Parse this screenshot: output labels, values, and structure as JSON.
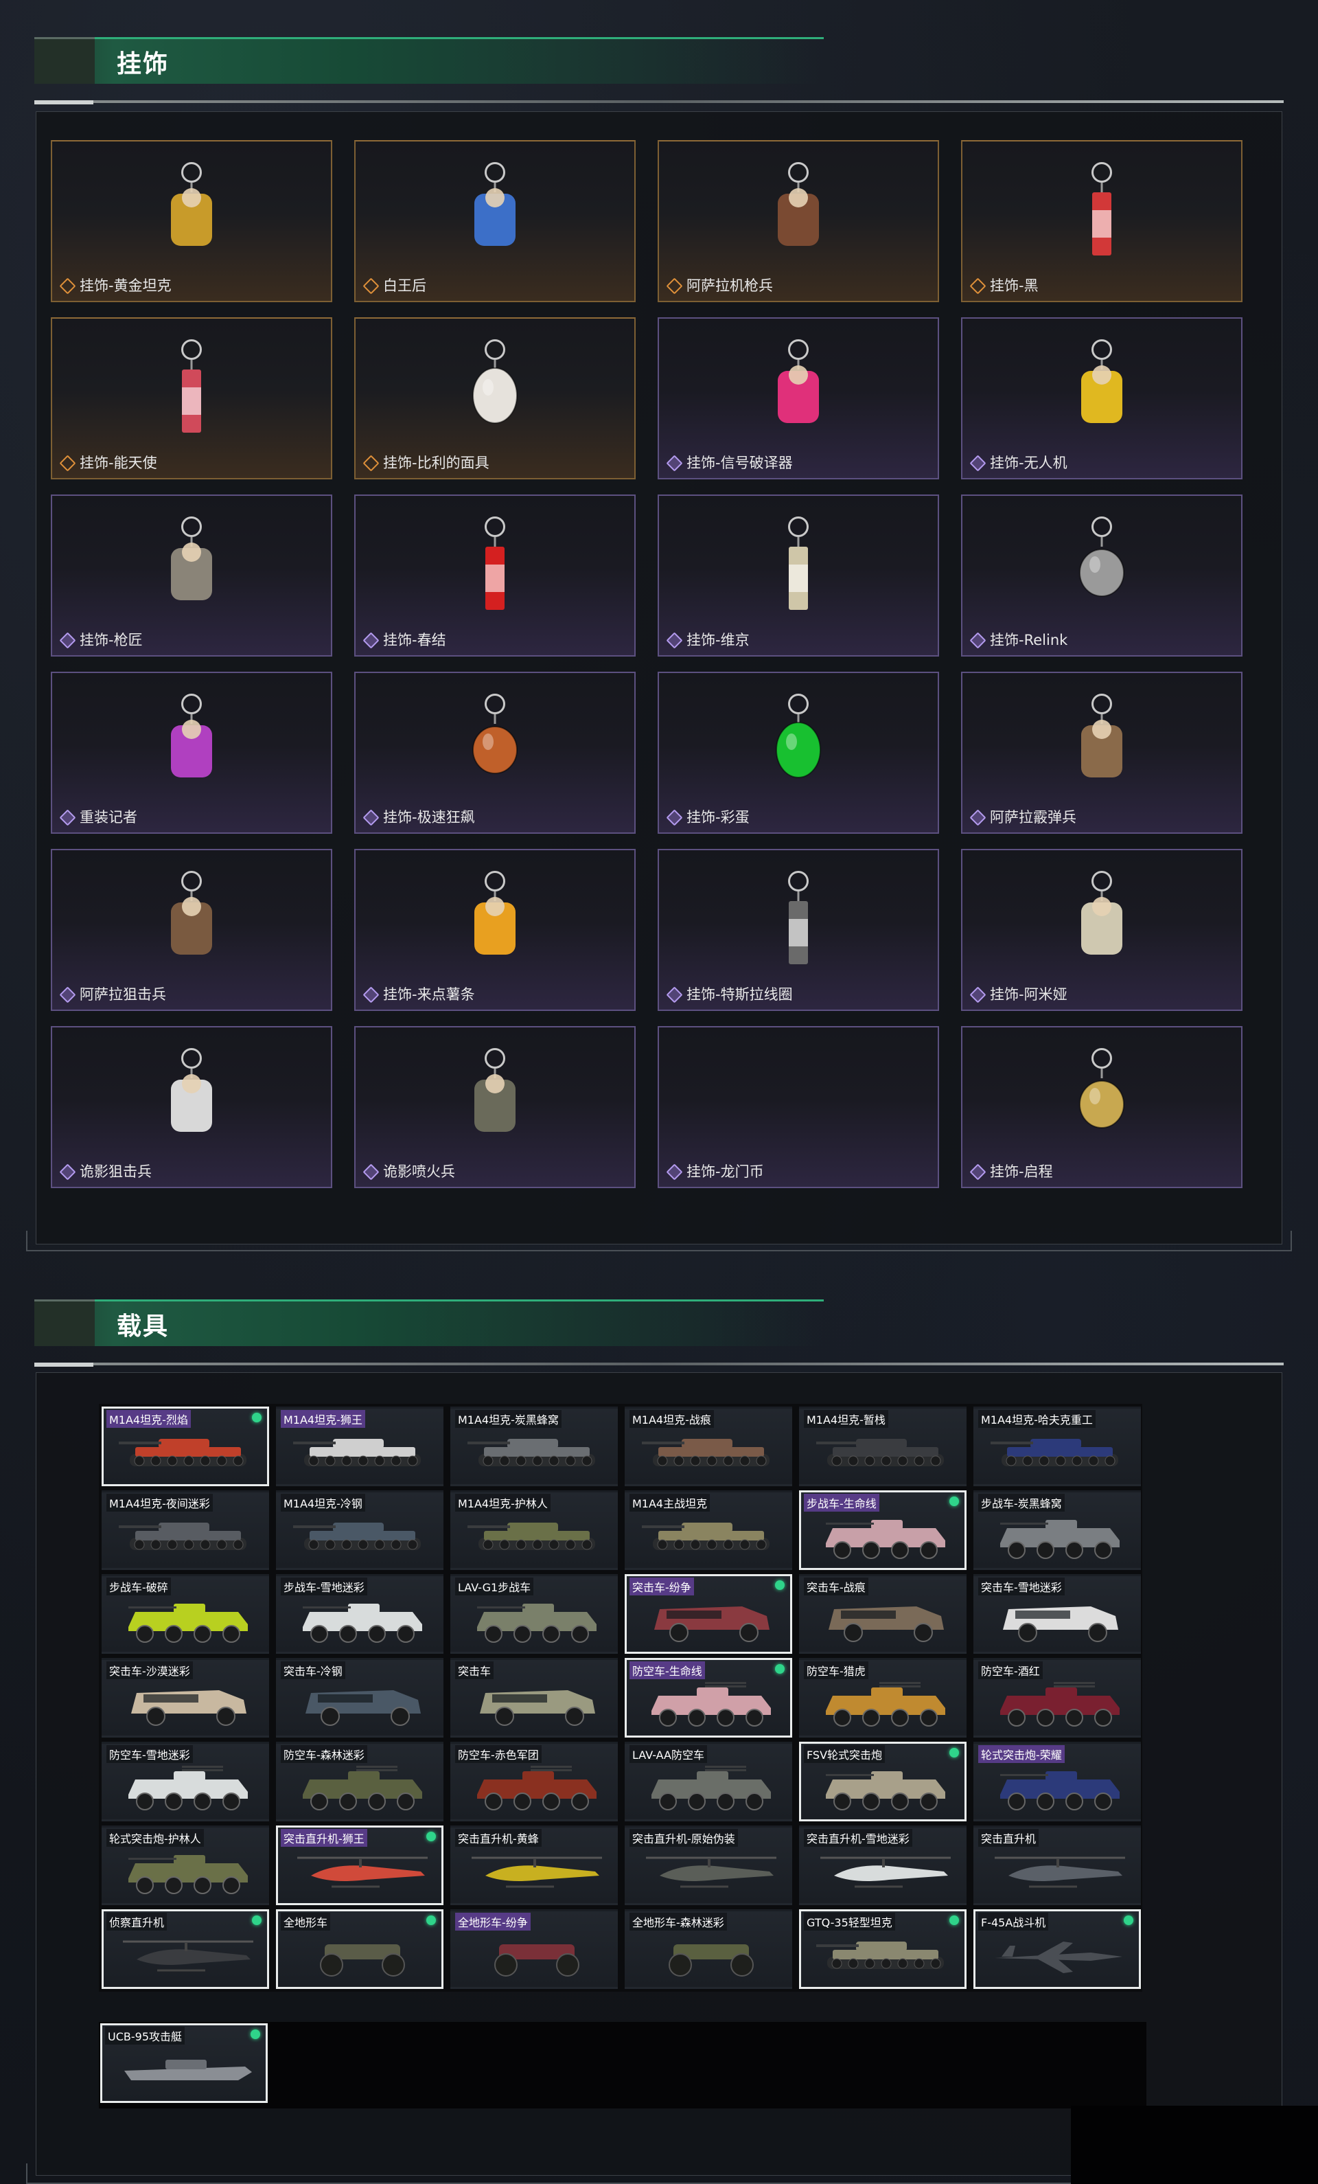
{
  "sections": {
    "charms": {
      "title": "挂饰"
    },
    "vehicles": {
      "title": "载具"
    }
  },
  "colors": {
    "accent_green": "#2fae7a",
    "rarity_gold": "#e0913a",
    "rarity_purple": "#b59cf0",
    "equipped_dot": "#2fd48a"
  },
  "charms": [
    {
      "name": "挂饰-黄金坦克",
      "rarity": "gold",
      "icon": "golden-tank-charm-icon",
      "color": "#c89b2a"
    },
    {
      "name": "白王后",
      "rarity": "gold",
      "icon": "white-queen-charm-icon",
      "color": "#3c6fc8"
    },
    {
      "name": "阿萨拉机枪兵",
      "rarity": "gold",
      "icon": "machine-gunner-charm-icon",
      "color": "#7a4a32"
    },
    {
      "name": "挂饰-黑",
      "rarity": "gold",
      "icon": "black-tag-charm-icon",
      "color": "#d23838"
    },
    {
      "name": "挂饰-能天使",
      "rarity": "gold",
      "icon": "exusiai-charm-icon",
      "color": "#d04a5a"
    },
    {
      "name": "挂饰-比利的面具",
      "rarity": "gold",
      "icon": "billy-mask-charm-icon",
      "color": "#e6e2dc"
    },
    {
      "name": "挂饰-信号破译器",
      "rarity": "purple",
      "icon": "signal-decoder-charm-icon",
      "color": "#e0307a"
    },
    {
      "name": "挂饰-无人机",
      "rarity": "purple",
      "icon": "drone-charm-icon",
      "color": "#e0b820"
    },
    {
      "name": "挂饰-枪匠",
      "rarity": "purple",
      "icon": "gunsmith-charm-icon",
      "color": "#8a8478"
    },
    {
      "name": "挂饰-春结",
      "rarity": "purple",
      "icon": "chinese-knot-charm-icon",
      "color": "#d42020"
    },
    {
      "name": "挂饰-维京",
      "rarity": "purple",
      "icon": "viking-hammer-charm-icon",
      "color": "#cfc6a8"
    },
    {
      "name": "挂饰-Relink",
      "rarity": "purple",
      "icon": "relink-emblem-charm-icon",
      "color": "#9a9a9a"
    },
    {
      "name": "重装记者",
      "rarity": "purple",
      "icon": "heavy-reporter-charm-icon",
      "color": "#b040c0"
    },
    {
      "name": "挂饰-极速狂飙",
      "rarity": "purple",
      "icon": "wheel-charm-icon",
      "color": "#c0602a"
    },
    {
      "name": "挂饰-彩蛋",
      "rarity": "purple",
      "icon": "easter-egg-charm-icon",
      "color": "#18c030"
    },
    {
      "name": "阿萨拉霰弹兵",
      "rarity": "purple",
      "icon": "shotgunner-charm-icon",
      "color": "#8a6a4a"
    },
    {
      "name": "阿萨拉狙击兵",
      "rarity": "purple",
      "icon": "sniper-charm-icon",
      "color": "#7a5a40"
    },
    {
      "name": "挂饰-来点薯条",
      "rarity": "purple",
      "icon": "fries-charm-icon",
      "color": "#e8a020"
    },
    {
      "name": "挂饰-特斯拉线圈",
      "rarity": "purple",
      "icon": "tesla-coil-charm-icon",
      "color": "#6a6a6a"
    },
    {
      "name": "挂饰-阿米娅",
      "rarity": "purple",
      "icon": "amiya-charm-icon",
      "color": "#cfc8b0"
    },
    {
      "name": "诡影狙击兵",
      "rarity": "purple",
      "icon": "shadow-sniper-charm-icon",
      "color": "#d8d8d8"
    },
    {
      "name": "诡影喷火兵",
      "rarity": "purple",
      "icon": "shadow-flamer-charm-icon",
      "color": "#6a6a5a"
    },
    {
      "name": "挂饰-龙门币",
      "rarity": "purple",
      "icon": "",
      "color": ""
    },
    {
      "name": "挂饰-启程",
      "rarity": "purple",
      "icon": "departure-coin-charm-icon",
      "color": "#c8a850"
    }
  ],
  "vehicles": [
    {
      "name": "M1A4坦克-烈焰",
      "type": "tank",
      "color": "#c0402a",
      "equipped": true,
      "tagged": true
    },
    {
      "name": "M1A4坦克-狮王",
      "type": "tank",
      "color": "#cfcfcf",
      "equipped": false,
      "tagged": true
    },
    {
      "name": "M1A4坦克-炭黑蜂窝",
      "type": "tank",
      "color": "#6a6e72",
      "equipped": false,
      "tagged": false
    },
    {
      "name": "M1A4坦克-战痕",
      "type": "tank",
      "color": "#7a5a48",
      "equipped": false,
      "tagged": false
    },
    {
      "name": "M1A4坦克-暂栈",
      "type": "tank",
      "color": "#3a3c40",
      "equipped": false,
      "tagged": false
    },
    {
      "name": "M1A4坦克-哈夫克重工",
      "type": "tank",
      "color": "#2c3a7a",
      "equipped": false,
      "tagged": false
    },
    {
      "name": "M1A4坦克-夜间迷彩",
      "type": "tank",
      "color": "#585c62",
      "equipped": false,
      "tagged": false
    },
    {
      "name": "M1A4坦克-冷钢",
      "type": "tank",
      "color": "#4a5866",
      "equipped": false,
      "tagged": false
    },
    {
      "name": "M1A4坦克-护林人",
      "type": "tank",
      "color": "#6a7048",
      "equipped": false,
      "tagged": false
    },
    {
      "name": "M1A4主战坦克",
      "type": "tank",
      "color": "#8a8460",
      "equipped": false,
      "tagged": false
    },
    {
      "name": "步战车-生命线",
      "type": "ifv",
      "color": "#c8a0a8",
      "equipped": true,
      "tagged": true
    },
    {
      "name": "步战车-炭黑蜂窝",
      "type": "ifv",
      "color": "#7a7e82",
      "equipped": false,
      "tagged": false
    },
    {
      "name": "步战车-破碎",
      "type": "ifv",
      "color": "#b8d020",
      "equipped": false,
      "tagged": false
    },
    {
      "name": "步战车-雪地迷彩",
      "type": "ifv",
      "color": "#d8dcdc",
      "equipped": false,
      "tagged": false
    },
    {
      "name": "LAV-G1步战车",
      "type": "ifv",
      "color": "#7a806a",
      "equipped": false,
      "tagged": false
    },
    {
      "name": "突击车-纷争",
      "type": "assault",
      "color": "#8a3a40",
      "equipped": true,
      "tagged": true
    },
    {
      "name": "突击车-战痕",
      "type": "assault",
      "color": "#7a6a58",
      "equipped": false,
      "tagged": false
    },
    {
      "name": "突击车-雪地迷彩",
      "type": "assault",
      "color": "#dcdcdc",
      "equipped": false,
      "tagged": false
    },
    {
      "name": "突击车-沙漠迷彩",
      "type": "assault",
      "color": "#c8b8a0",
      "equipped": false,
      "tagged": false
    },
    {
      "name": "突击车-冷钢",
      "type": "assault",
      "color": "#4a5866",
      "equipped": false,
      "tagged": false
    },
    {
      "name": "突击车",
      "type": "assault",
      "color": "#9a9a80",
      "equipped": false,
      "tagged": false
    },
    {
      "name": "防空车-生命线",
      "type": "aa",
      "color": "#d0a0a8",
      "equipped": true,
      "tagged": true
    },
    {
      "name": "防空车-猎虎",
      "type": "aa",
      "color": "#c08a30",
      "equipped": false,
      "tagged": false
    },
    {
      "name": "防空车-酒红",
      "type": "aa",
      "color": "#7a2030",
      "equipped": false,
      "tagged": false
    },
    {
      "name": "防空车-雪地迷彩",
      "type": "aa",
      "color": "#d8dcdc",
      "equipped": false,
      "tagged": false
    },
    {
      "name": "防空车-森林迷彩",
      "type": "aa",
      "color": "#5a6040",
      "equipped": false,
      "tagged": false
    },
    {
      "name": "防空车-赤色军团",
      "type": "aa",
      "color": "#8a3020",
      "equipped": false,
      "tagged": false
    },
    {
      "name": "LAV-AA防空车",
      "type": "aa",
      "color": "#6a6e68",
      "equipped": false,
      "tagged": false
    },
    {
      "name": "FSV轮式突击炮",
      "type": "fsv",
      "color": "#a8a08a",
      "equipped": true,
      "tagged": false
    },
    {
      "name": "轮式突击炮-荣耀",
      "type": "fsv",
      "color": "#2c3a7a",
      "equipped": false,
      "tagged": true
    },
    {
      "name": "轮式突击炮-护林人",
      "type": "fsv",
      "color": "#6a7048",
      "equipped": false,
      "tagged": false
    },
    {
      "name": "突击直升机-狮王",
      "type": "heli",
      "color": "#d04a3a",
      "equipped": true,
      "tagged": true
    },
    {
      "name": "突击直升机-黄蜂",
      "type": "heli",
      "color": "#c8b020",
      "equipped": false,
      "tagged": false
    },
    {
      "name": "突击直升机-原始伪装",
      "type": "heli",
      "color": "#5a5e58",
      "equipped": false,
      "tagged": false
    },
    {
      "name": "突击直升机-雪地迷彩",
      "type": "heli",
      "color": "#d8dcdc",
      "equipped": false,
      "tagged": false
    },
    {
      "name": "突击直升机",
      "type": "heli",
      "color": "#5a6068",
      "equipped": false,
      "tagged": false
    },
    {
      "name": "侦察直升机",
      "type": "scout",
      "color": "#3a3c40",
      "equipped": true,
      "tagged": false
    },
    {
      "name": "全地形车",
      "type": "atv",
      "color": "#5a5c48",
      "equipped": true,
      "tagged": false
    },
    {
      "name": "全地形车-纷争",
      "type": "atv",
      "color": "#7a3038",
      "equipped": false,
      "tagged": true
    },
    {
      "name": "全地形车-森林迷彩",
      "type": "atv",
      "color": "#5a6040",
      "equipped": false,
      "tagged": false
    },
    {
      "name": "GTQ-35轻型坦克",
      "type": "tank",
      "color": "#8a8870",
      "equipped": true,
      "tagged": false
    },
    {
      "name": "F-45A战斗机",
      "type": "jet",
      "color": "#4a4e54",
      "equipped": true,
      "tagged": false
    }
  ],
  "extra_vehicle": {
    "name": "UCB-95攻击艇",
    "type": "boat",
    "color": "#8a8e94",
    "equipped": true,
    "tagged": false
  }
}
